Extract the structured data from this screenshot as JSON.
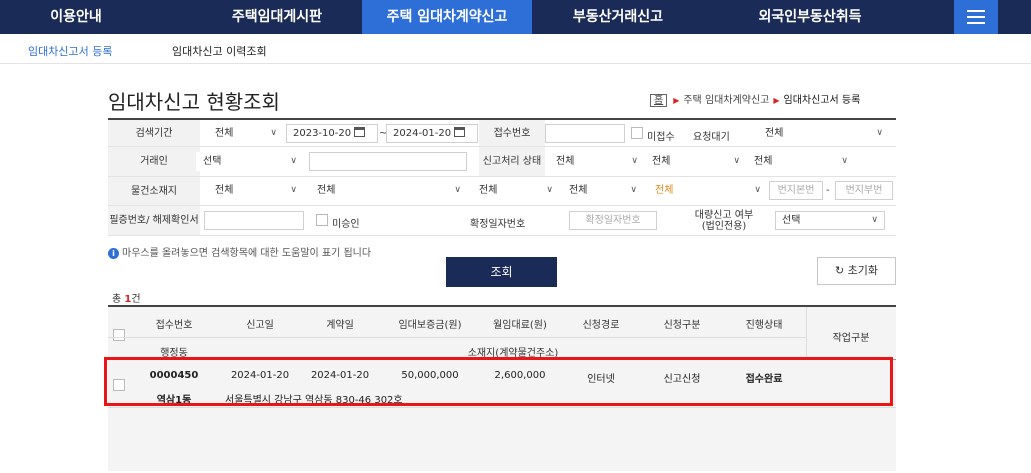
{
  "topnav": {
    "items": [
      {
        "label": "이용안내"
      },
      {
        "label": "주택임대게시판"
      },
      {
        "label": "주택 임대차계약신고"
      },
      {
        "label": "부동산거래신고"
      },
      {
        "label": "외국인부동산취득"
      }
    ],
    "active_index": 2,
    "menu_icon": "hamburger-icon"
  },
  "subnav": {
    "items": [
      {
        "label": "임대차신고서 등록"
      },
      {
        "label": "임대차신고 이력조회"
      }
    ]
  },
  "page": {
    "title": "임대차신고 현황조회",
    "breadcrumb": {
      "home": "홈",
      "mid": "주택 임대차계약신고",
      "current": "임대차신고서 등록"
    }
  },
  "search_form": {
    "period_label": "검색기간",
    "period_select": "전체",
    "date_from": "2023-10-20",
    "date_sep": "~",
    "date_to": "2024-01-20",
    "receipt_no_label": "접수번호",
    "receipt_no_value": "",
    "unreceived_label": "미접수",
    "request_wait_label": "요청대기",
    "request_wait_select": "전체",
    "party_label": "거래인",
    "party_select": "선택",
    "party_value": "",
    "process_label": "신고처리 상태",
    "process_select_1": "전체",
    "process_select_2": "전체",
    "process_select_3": "전체",
    "location_label": "물건소재지",
    "loc_1": "전체",
    "loc_2": "전체",
    "loc_3": "전체",
    "loc_4": "전체",
    "loc_5": "전체",
    "main_no_placeholder": "번지본번",
    "dash": "-",
    "sub_no_placeholder": "번지부번",
    "cert_label": "필증번호/ 해제확인서",
    "cert_value": "",
    "unapproved_label": "미승인",
    "fixed_date_label": "확정일자번호",
    "fixed_date_placeholder": "확정일자번호",
    "bulk_label": "대량신고 여부 (법인전용)",
    "bulk_select": "선택"
  },
  "notice": "마우스를 올려놓으면 검색항목에 대한 도움말이 표기 됩니다",
  "buttons": {
    "search": "조회",
    "reset": "초기화"
  },
  "total": {
    "prefix": "총 ",
    "count": "1",
    "suffix": "건"
  },
  "table": {
    "headers_row1": [
      "접수번호",
      "신고일",
      "계약일",
      "임대보증금(원)",
      "월임대료(원)",
      "신청경로",
      "신청구분",
      "진행상태"
    ],
    "header_work": "작업구분",
    "headers_row2": {
      "district": "행정동",
      "address": "소재지(계약물건주소)"
    },
    "rows": [
      {
        "receipt_no": "0000450",
        "report_date": "2024-01-20",
        "contract_date": "2024-01-20",
        "deposit": "50,000,000",
        "monthly_rent": "2,600,000",
        "channel": "인터넷",
        "type": "신고신청",
        "status": "접수완료",
        "district": "역삼1동",
        "address": "서울특별시 강남구 역삼동 830-46 302호"
      }
    ]
  },
  "colors": {
    "nav_bg": "#1a2b58",
    "nav_active": "#2d6fd6",
    "highlight": "#ec1414",
    "count": "#d22222"
  }
}
